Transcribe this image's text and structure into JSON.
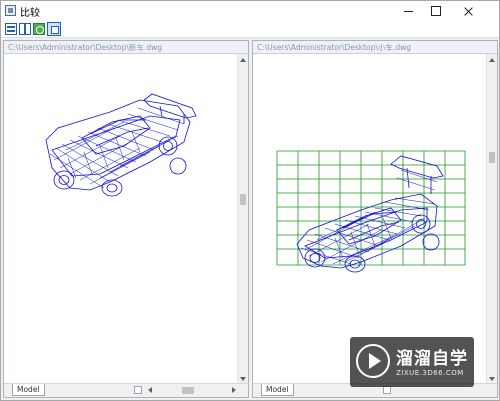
{
  "window": {
    "title": "比较",
    "controls": [
      "minimize",
      "maximize",
      "close"
    ]
  },
  "toolbar": {
    "buttons": [
      {
        "icon": "horizontal-split-icon"
      },
      {
        "icon": "vertical-split-icon"
      },
      {
        "icon": "refresh-icon"
      },
      {
        "icon": "zoom-extents-icon"
      }
    ]
  },
  "panes": {
    "left": {
      "path": "C:\\Users\\Administrator\\Desktop\\新车.dwg",
      "tab": "Model",
      "drawing_color": "#1010d8",
      "has_grid": false
    },
    "right": {
      "path": "C:\\Users\\Administrator\\Desktop\\小车.dwg",
      "tab": "Model",
      "drawing_color": "#1010d8",
      "grid_color": "#1a9a1a",
      "has_grid": true
    }
  },
  "watermark": {
    "brand": "溜溜自学",
    "url": "ZIXUE.3D66.COM"
  }
}
